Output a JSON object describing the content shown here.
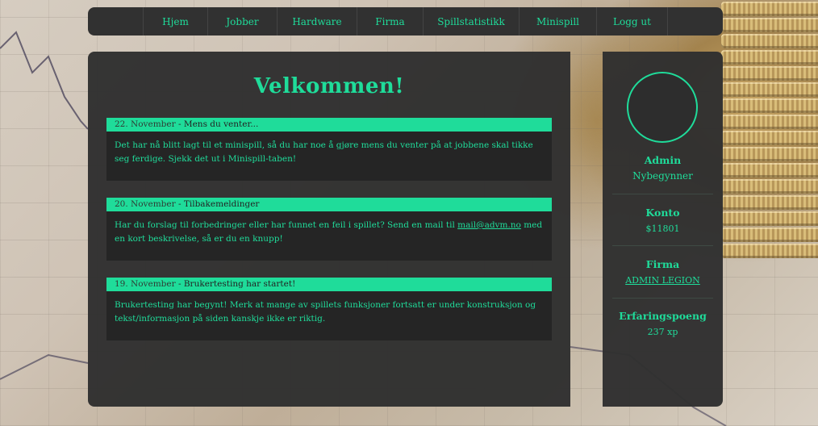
{
  "nav": {
    "items": [
      {
        "label": "Hjem"
      },
      {
        "label": "Jobber"
      },
      {
        "label": "Hardware"
      },
      {
        "label": "Firma"
      },
      {
        "label": "Spillstatistikk"
      },
      {
        "label": "Minispill"
      },
      {
        "label": "Logg ut"
      }
    ]
  },
  "main": {
    "title": "Velkommen!",
    "news": [
      {
        "date": "22. November",
        "sep": " - ",
        "title": "Mens du venter...",
        "body": "Det har nå blitt lagt til et minispill, så du har noe å gjøre mens du venter på at jobbene skal tikke seg ferdige. Sjekk det ut i Minispill-taben!"
      },
      {
        "date": "20. November",
        "sep": " - ",
        "title": "Tilbakemeldinger",
        "body_pre": "Har du forslag til forbedringer eller har funnet en feil i spillet? Send en mail til ",
        "link": "mail@advm.no",
        "body_post": " med en kort beskrivelse, så er du en knupp!"
      },
      {
        "date": "19. November",
        "sep": " - ",
        "title": "Brukertesting har startet!",
        "body": "Brukertesting har begynt! Merk at mange av spillets funksjoner fortsatt er under konstruksjon og tekst/informasjon på siden kanskje ikke er riktig."
      }
    ]
  },
  "sidebar": {
    "username": "Admin",
    "rank": "Nybegynner",
    "account_label": "Konto",
    "account_value": "$11801",
    "company_label": "Firma",
    "company_value": "ADMIN LEGION",
    "xp_label": "Erfaringspoeng",
    "xp_value": "237 xp"
  },
  "colors": {
    "accent": "#1fdc9a",
    "panel": "#303030",
    "news_body": "#252525"
  }
}
